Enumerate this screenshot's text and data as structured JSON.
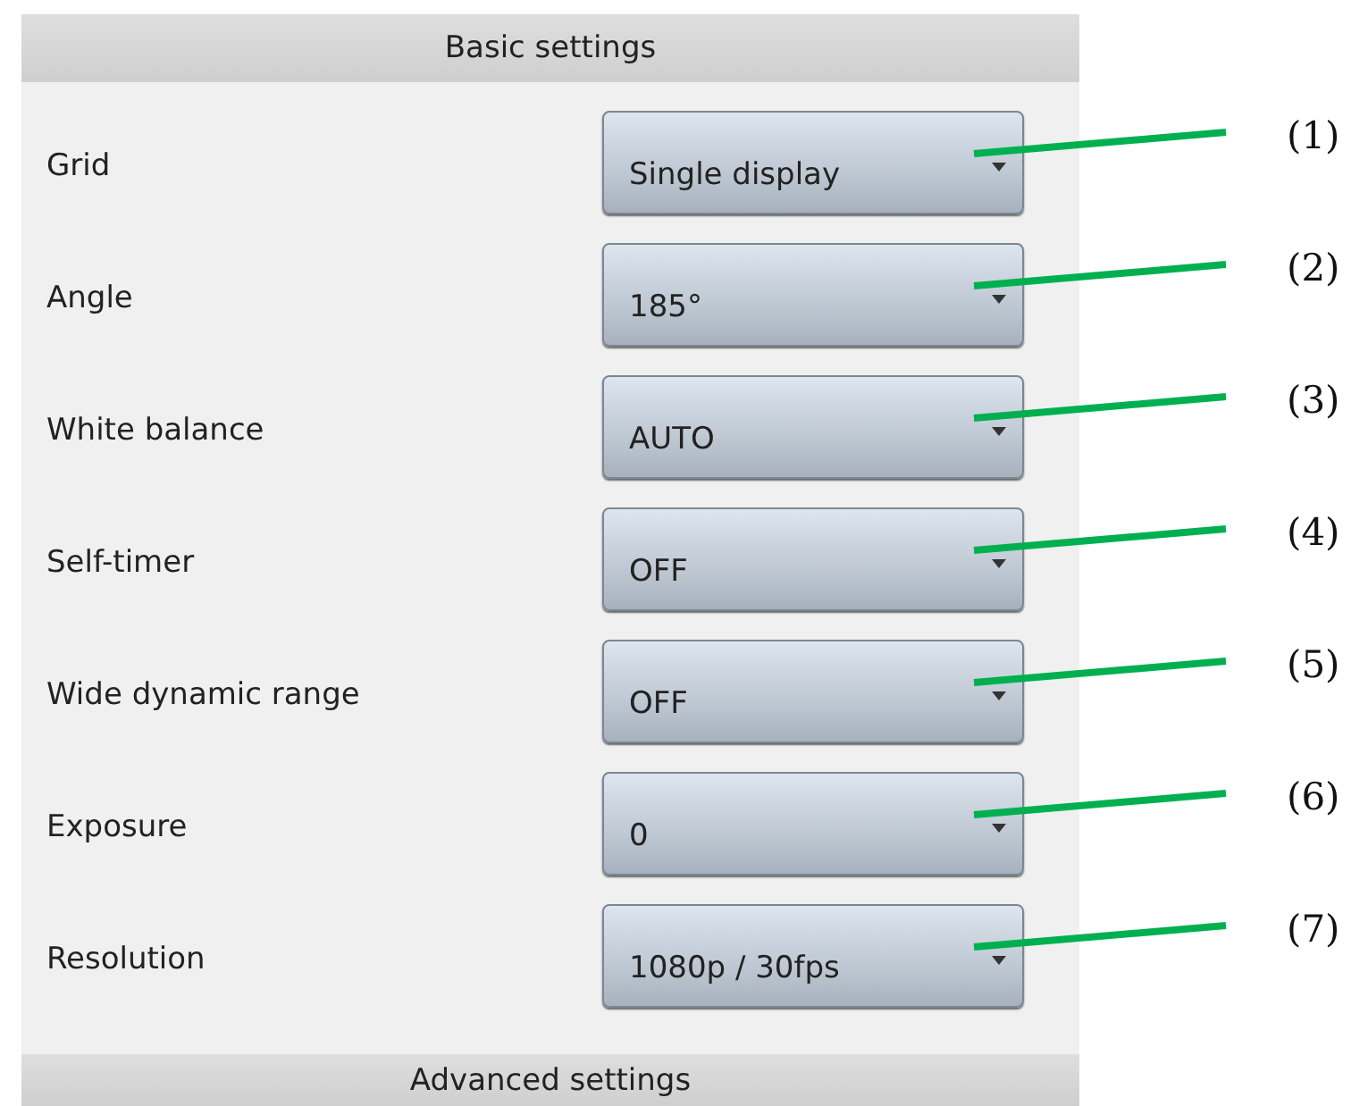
{
  "header": {
    "title": "Basic settings"
  },
  "settings": [
    {
      "label": "Grid",
      "value": "Single display",
      "callout": "(1)"
    },
    {
      "label": "Angle",
      "value": "185°",
      "callout": "(2)"
    },
    {
      "label": "White balance",
      "value": "AUTO",
      "callout": "(3)"
    },
    {
      "label": "Self-timer",
      "value": "OFF",
      "callout": "(4)"
    },
    {
      "label": "Wide dynamic range",
      "value": "OFF",
      "callout": "(5)"
    },
    {
      "label": "Exposure",
      "value": "0",
      "callout": "(6)"
    },
    {
      "label": "Resolution",
      "value": "1080p / 30fps",
      "callout": "(7)"
    }
  ],
  "footer": {
    "title": "Advanced settings"
  }
}
